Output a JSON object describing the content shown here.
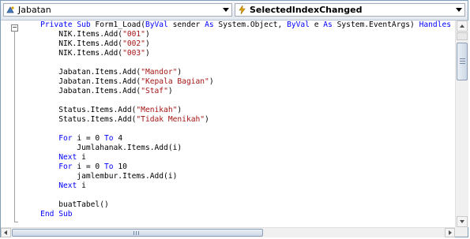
{
  "dropdowns": {
    "object": {
      "icon": "class-object-icon",
      "value": "Jabatan"
    },
    "event": {
      "icon": "lightning-event-icon",
      "value": "SelectedIndexChanged"
    }
  },
  "colors": {
    "keyword": "#0000ff",
    "string": "#a31515",
    "text": "#000000"
  },
  "code_lines": [
    [
      {
        "t": "    "
      },
      {
        "t": "Private Sub",
        "k": "kw"
      },
      {
        "t": " Form1_Load("
      },
      {
        "t": "ByVal",
        "k": "kw"
      },
      {
        "t": " sender "
      },
      {
        "t": "As",
        "k": "kw"
      },
      {
        "t": " System.Object, "
      },
      {
        "t": "ByVal",
        "k": "kw"
      },
      {
        "t": " e "
      },
      {
        "t": "As",
        "k": "kw"
      },
      {
        "t": " System.EventArgs) "
      },
      {
        "t": "Handles",
        "k": "kw"
      }
    ],
    [
      {
        "t": "        NIK.Items.Add("
      },
      {
        "t": "\"001\"",
        "k": "str"
      },
      {
        "t": ")"
      }
    ],
    [
      {
        "t": "        NIK.Items.Add("
      },
      {
        "t": "\"002\"",
        "k": "str"
      },
      {
        "t": ")"
      }
    ],
    [
      {
        "t": "        NIK.Items.Add("
      },
      {
        "t": "\"003\"",
        "k": "str"
      },
      {
        "t": ")"
      }
    ],
    [
      {
        "t": ""
      }
    ],
    [
      {
        "t": "        Jabatan.Items.Add("
      },
      {
        "t": "\"Mandor\"",
        "k": "str"
      },
      {
        "t": ")"
      }
    ],
    [
      {
        "t": "        Jabatan.Items.Add("
      },
      {
        "t": "\"Kepala Bagian\"",
        "k": "str"
      },
      {
        "t": ")"
      }
    ],
    [
      {
        "t": "        Jabatan.Items.Add("
      },
      {
        "t": "\"Staf\"",
        "k": "str"
      },
      {
        "t": ")"
      }
    ],
    [
      {
        "t": ""
      }
    ],
    [
      {
        "t": "        Status.Items.Add("
      },
      {
        "t": "\"Menikah\"",
        "k": "str"
      },
      {
        "t": ")"
      }
    ],
    [
      {
        "t": "        Status.Items.Add("
      },
      {
        "t": "\"Tidak Menikah\"",
        "k": "str"
      },
      {
        "t": ")"
      }
    ],
    [
      {
        "t": ""
      }
    ],
    [
      {
        "t": "        "
      },
      {
        "t": "For",
        "k": "kw"
      },
      {
        "t": " i = 0 "
      },
      {
        "t": "To",
        "k": "kw"
      },
      {
        "t": " 4"
      }
    ],
    [
      {
        "t": "            Jumlahanak.Items.Add(i)"
      }
    ],
    [
      {
        "t": "        "
      },
      {
        "t": "Next",
        "k": "kw"
      },
      {
        "t": " i"
      }
    ],
    [
      {
        "t": "        "
      },
      {
        "t": "For",
        "k": "kw"
      },
      {
        "t": " i = 0 "
      },
      {
        "t": "To",
        "k": "kw"
      },
      {
        "t": " 10"
      }
    ],
    [
      {
        "t": "            jamlembur.Items.Add(i)"
      }
    ],
    [
      {
        "t": "        "
      },
      {
        "t": "Next",
        "k": "kw"
      },
      {
        "t": " i"
      }
    ],
    [
      {
        "t": ""
      }
    ],
    [
      {
        "t": "        buatTabel()"
      }
    ],
    [
      {
        "t": "    "
      },
      {
        "t": "End Sub",
        "k": "kw"
      }
    ]
  ],
  "outline": {
    "toggle_symbol": "−"
  },
  "scrollbars": {
    "vertical": {
      "up_icon": "arrow-up-icon",
      "down_icon": "arrow-down-icon"
    },
    "horizontal": {
      "left_icon": "arrow-left-icon",
      "right_icon": "arrow-right-icon"
    }
  }
}
